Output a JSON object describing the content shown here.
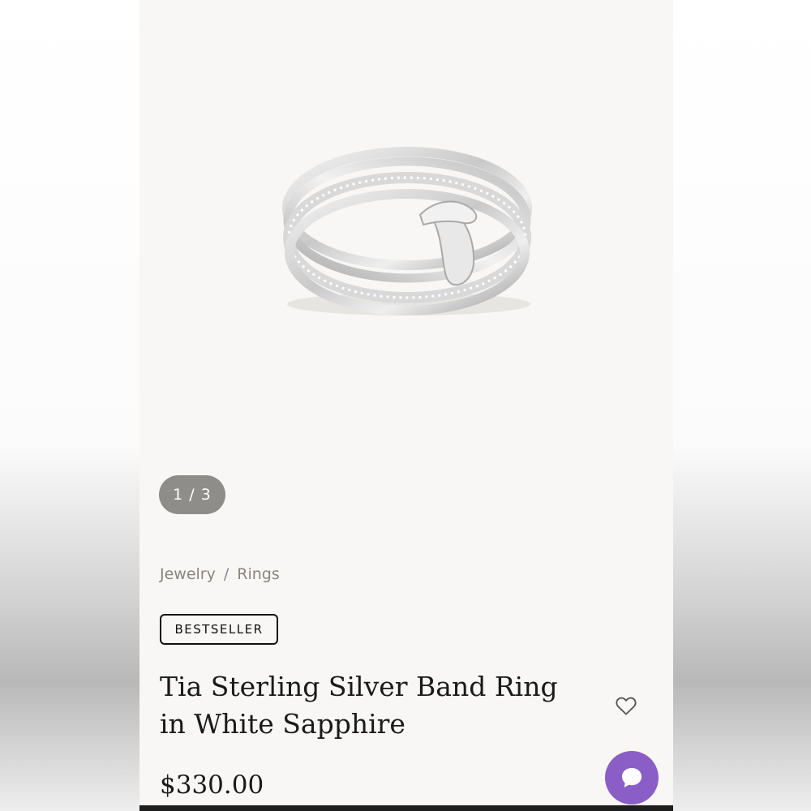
{
  "gallery": {
    "image_alt": "Tia Sterling Silver Band Ring in White Sapphire",
    "counter": "1 / 3"
  },
  "breadcrumb": {
    "items": [
      "Jewelry",
      "Rings"
    ],
    "separator": "/"
  },
  "product": {
    "badge": "BESTSELLER",
    "title": "Tia Sterling Silver Band Ring in White Sapphire",
    "price": "$330.00"
  },
  "icons": {
    "wishlist": "heart-icon",
    "chat": "chat-bubble-icon"
  },
  "colors": {
    "chat_button": "#8a5ec6",
    "counter_pill": "#8f8d8a",
    "page_background": "#f8f7f5"
  }
}
